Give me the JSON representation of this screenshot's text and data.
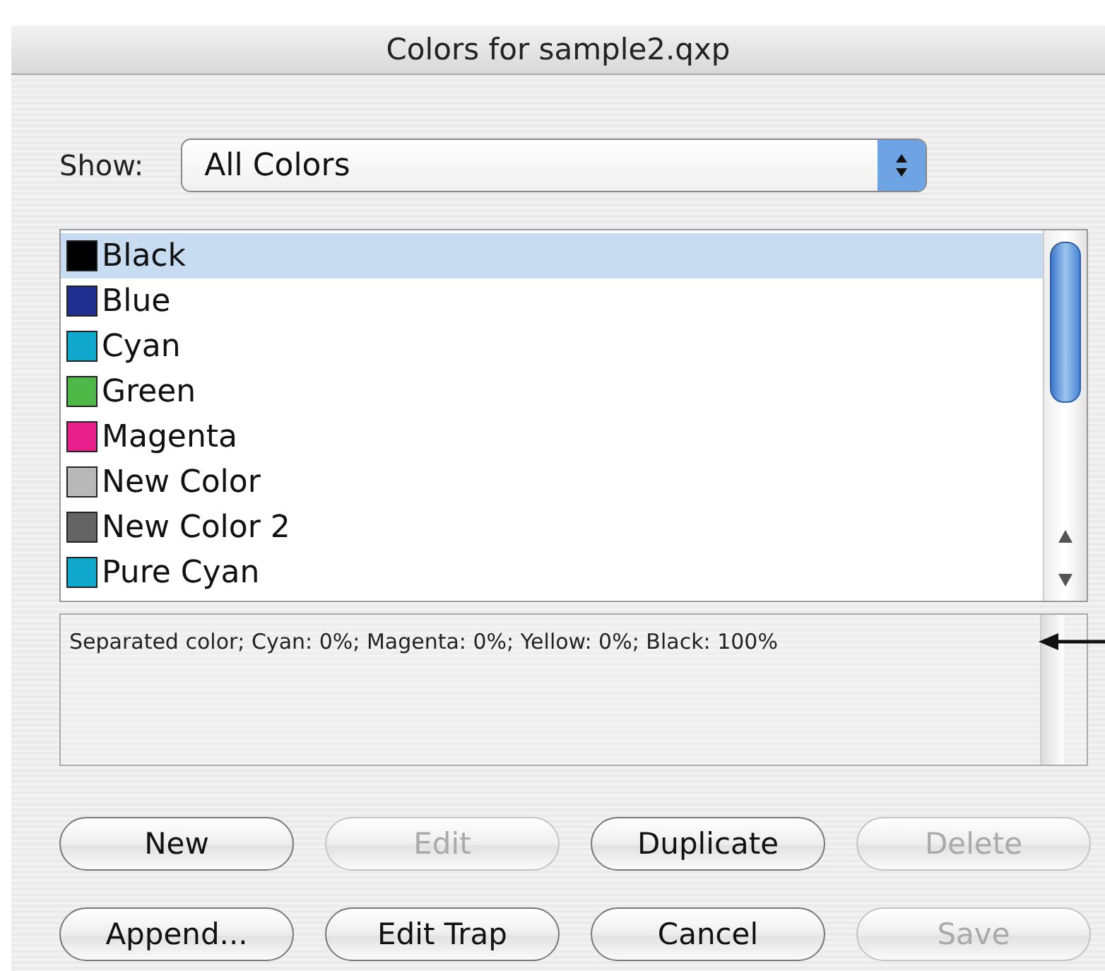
{
  "window": {
    "title": "Colors for sample2.qxp"
  },
  "show": {
    "label": "Show:",
    "value": "All Colors"
  },
  "colors": [
    {
      "name": "Black",
      "color": "#000000",
      "selected": true
    },
    {
      "name": "Blue",
      "color": "#1f2f8f",
      "selected": false
    },
    {
      "name": "Cyan",
      "color": "#10a8cc",
      "selected": false
    },
    {
      "name": "Green",
      "color": "#4db848",
      "selected": false
    },
    {
      "name": "Magenta",
      "color": "#e8208c",
      "selected": false
    },
    {
      "name": "New Color",
      "color": "#b8b8b8",
      "selected": false
    },
    {
      "name": "New Color 2",
      "color": "#646464",
      "selected": false
    },
    {
      "name": "Pure Cyan",
      "color": "#10a8cc",
      "selected": false
    }
  ],
  "description": "Separated color; Cyan: 0%; Magenta: 0%; Yellow: 0%; Black: 100%",
  "buttons": [
    {
      "label": "New",
      "disabled": false
    },
    {
      "label": "Edit",
      "disabled": true
    },
    {
      "label": "Duplicate",
      "disabled": false
    },
    {
      "label": "Delete",
      "disabled": true
    },
    {
      "label": "Append...",
      "disabled": false
    },
    {
      "label": "Edit Trap",
      "disabled": false
    },
    {
      "label": "Cancel",
      "disabled": false
    },
    {
      "label": "Save",
      "disabled": true
    }
  ]
}
